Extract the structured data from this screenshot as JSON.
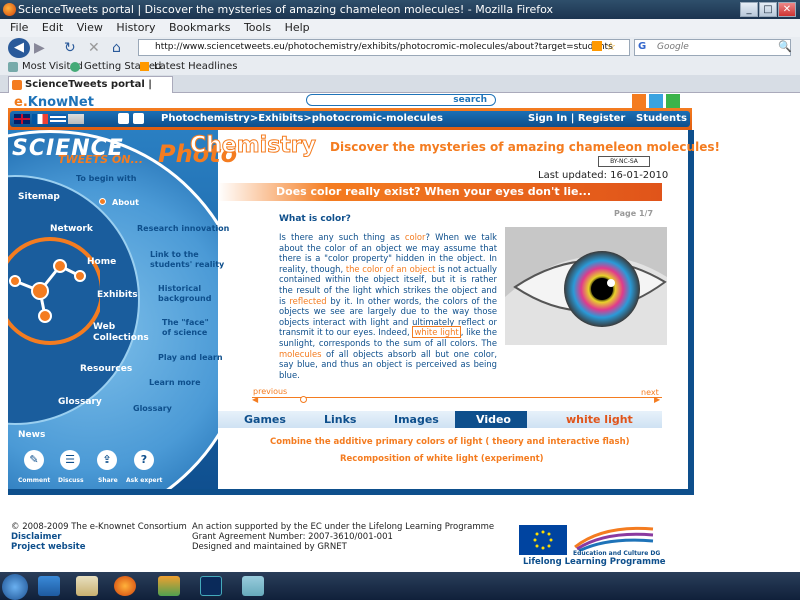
{
  "window": {
    "title": "ScienceTweets portal | Discover the mysteries of amazing chameleon molecules! - Mozilla Firefox",
    "min": "_",
    "max": "□",
    "close": "✕"
  },
  "menu": [
    "File",
    "Edit",
    "View",
    "History",
    "Bookmarks",
    "Tools",
    "Help"
  ],
  "nav": {
    "url": "http://www.sciencetweets.eu/photochemistry/exhibits/photocromic-molecules/about?target=students",
    "search_placeholder": "Google"
  },
  "bookmarks": [
    "Most Visited",
    "Getting Started",
    "Latest Headlines"
  ],
  "tab": {
    "label": "ScienceTweets portal | Discover the ..."
  },
  "site": {
    "brand_prefix": "e.",
    "brand_name": "KnowNet",
    "search_label": "search",
    "breadcrumb": "Photochemistry>Exhibits>photocromic-molecules",
    "signin": "Sign In | Register",
    "audience": "Students",
    "logo_science": "SCIENCE",
    "logo_tweets": "TWEETS ON...",
    "logo_photo": "Photo",
    "logo_chem": "Chemistry"
  },
  "leftnav": {
    "main": [
      "Sitemap",
      "Network",
      "Home",
      "Exhibits",
      "Web Collections",
      "Resources",
      "Glossary",
      "News"
    ],
    "sub": [
      "To begin with",
      "About",
      "Research innovation",
      "Link to the students' reality",
      "Historical background",
      "The \"face\" of science",
      "Play and learn",
      "Learn more",
      "Glossary"
    ],
    "bottom_icons": [
      "Comment",
      "Discuss",
      "Share",
      "Ask expert"
    ]
  },
  "content": {
    "headline": "Discover the mysteries of amazing chameleon molecules!",
    "license": "BY-NC-SA",
    "updated": "Last updated: 16-01-2010",
    "question": "Does color really exist? When your eyes don't lie...",
    "page": "Page 1/7",
    "section_title": "What is color?",
    "p1": "Is there any such thing as ",
    "w_color": "color",
    "p2": "? When we talk about the color of an object we may assume that there is a \"color property\" hidden in the object. In reality, though, ",
    "w_colorobj": "the color of an object",
    "p3": " is not actually contained within the object itself, but it is rather the result of the light which strikes the object and is ",
    "w_reflected": "reflected",
    "p4": " by it.  In other words, the colors of the objects we see are largely due to the way those objects interact with light and ultimately reflect or transmit it to our eyes. Indeed, ",
    "w_white": "white light",
    "p5": ", like the sunlight, corresponds to the sum of all colors. The ",
    "w_molecules": "molecules",
    "p6": " of all objects absorb all but one color, say blue, and thus an object is perceived as being blue.",
    "previous": "previous",
    "next": "next",
    "tabs": [
      "Games",
      "Links",
      "Images",
      "Video",
      "white light"
    ],
    "link1": "Combine the additive primary colors of light ( theory and interactive flash)",
    "link2": "Recomposition of white light (experiment)"
  },
  "footer": {
    "copyright": "© 2008-2009 The e-Knownet Consortium",
    "disclaimer": "Disclaimer",
    "project": "Project website",
    "l1": "An action supported by the EC under the Lifelong Learning Programme",
    "l2": "Grant Agreement Number: 2007-3610/001-001",
    "l3": "Designed and maintained by GRNET",
    "lifelong": "Lifelong  Learning  Programme",
    "edu": "Education and Culture DG"
  },
  "colors": {
    "orange": "#f47c20",
    "blue": "#0e4f8c"
  }
}
